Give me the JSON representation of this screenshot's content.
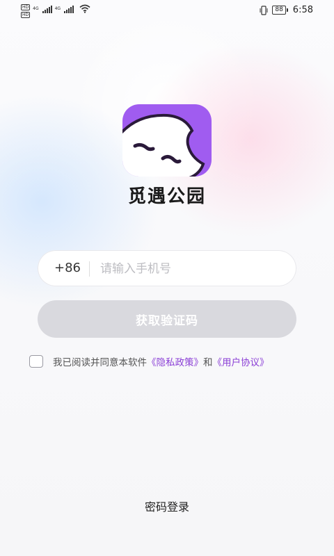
{
  "status_bar": {
    "hd_labels": [
      "HD",
      "HD"
    ],
    "network_labels": [
      "4G",
      "4G"
    ],
    "battery": "88",
    "time": "6:58"
  },
  "app": {
    "name": "觅遇公园",
    "brand_color": "#a05cf0"
  },
  "login": {
    "country_code": "+86",
    "phone_placeholder": "请输入手机号",
    "get_code_label": "获取验证码",
    "agreement_text": "我已阅读并同意本软件",
    "privacy_link": "《隐私政策》",
    "and_text": "和",
    "terms_link": "《用户协议》",
    "password_login_label": "密码登录"
  }
}
